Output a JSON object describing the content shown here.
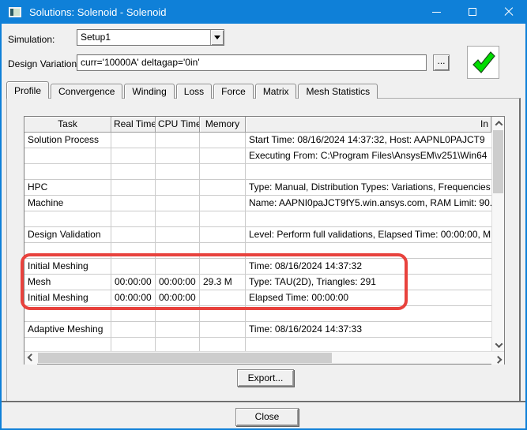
{
  "window": {
    "title": "Solutions: Solenoid - Solenoid"
  },
  "simulation": {
    "label": "Simulation:",
    "value": "Setup1"
  },
  "design_variation": {
    "label": "Design Variation:",
    "value": "curr='10000A' deltagap='0in'",
    "browse_label": "..."
  },
  "tabs": [
    {
      "label": "Profile",
      "active": true
    },
    {
      "label": "Convergence",
      "active": false
    },
    {
      "label": "Winding",
      "active": false
    },
    {
      "label": "Loss",
      "active": false
    },
    {
      "label": "Force",
      "active": false
    },
    {
      "label": "Matrix",
      "active": false
    },
    {
      "label": "Mesh Statistics",
      "active": false
    }
  ],
  "table": {
    "headers": [
      "Task",
      "Real Time",
      "CPU Time",
      "Memory",
      "In"
    ],
    "rows": [
      {
        "task": "Solution Process",
        "real_time": "",
        "cpu_time": "",
        "memory": "",
        "info": "Start Time: 08/16/2024 14:37:32, Host: AAPNL0PAJCT9"
      },
      {
        "task": "",
        "real_time": "",
        "cpu_time": "",
        "memory": "",
        "info": "Executing From: C:\\Program Files\\AnsysEM\\v251\\Win64"
      },
      {
        "task": "",
        "real_time": "",
        "cpu_time": "",
        "memory": "",
        "info": ""
      },
      {
        "task": "HPC",
        "real_time": "",
        "cpu_time": "",
        "memory": "",
        "info": "Type: Manual, Distribution Types: Variations, Frequencies"
      },
      {
        "task": "Machine",
        "real_time": "",
        "cpu_time": "",
        "memory": "",
        "info": "Name: AAPNI0paJCT9fY5.win.ansys.com, RAM Limit: 90."
      },
      {
        "task": "",
        "real_time": "",
        "cpu_time": "",
        "memory": "",
        "info": ""
      },
      {
        "task": "Design Validation",
        "real_time": "",
        "cpu_time": "",
        "memory": "",
        "info": "Level: Perform full validations, Elapsed Time: 00:00:00, M"
      },
      {
        "task": "",
        "real_time": "",
        "cpu_time": "",
        "memory": "",
        "info": ""
      },
      {
        "task": "Initial Meshing",
        "real_time": "",
        "cpu_time": "",
        "memory": "",
        "info": "Time: 08/16/2024 14:37:32"
      },
      {
        "task": "Mesh",
        "real_time": "00:00:00",
        "cpu_time": "00:00:00",
        "memory": "29.3 M",
        "info": "Type: TAU(2D), Triangles: 291"
      },
      {
        "task": "Initial Meshing",
        "real_time": "00:00:00",
        "cpu_time": "00:00:00",
        "memory": "",
        "info": "Elapsed Time: 00:00:00"
      },
      {
        "task": "",
        "real_time": "",
        "cpu_time": "",
        "memory": "",
        "info": ""
      },
      {
        "task": "Adaptive Meshing",
        "real_time": "",
        "cpu_time": "",
        "memory": "",
        "info": "Time: 08/16/2024 14:37:33"
      },
      {
        "task": "",
        "real_time": "",
        "cpu_time": "",
        "memory": "",
        "info": ""
      }
    ]
  },
  "buttons": {
    "export": "Export...",
    "close": "Close"
  },
  "colors": {
    "titlebar": "#0f80d8",
    "highlight_red": "#e8423d",
    "check_green": "#00dd00"
  }
}
